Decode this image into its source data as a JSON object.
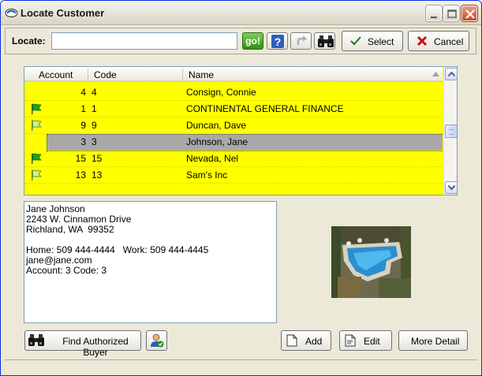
{
  "window": {
    "title": "Locate Customer"
  },
  "toolbar": {
    "locate_label": "Locate:",
    "locate_value": "",
    "go_label": "go!",
    "select_label": "Select",
    "cancel_label": "Cancel"
  },
  "grid": {
    "columns": [
      "Account",
      "Code",
      "Name"
    ],
    "rows": [
      {
        "account": "4",
        "code": "4",
        "name": "Consign, Connie",
        "flag": "none",
        "selected": false
      },
      {
        "account": "1",
        "code": "1",
        "name": "CONTINENTAL GENERAL FINANCE",
        "flag": "green",
        "selected": false
      },
      {
        "account": "9",
        "code": "9",
        "name": "Duncan, Dave",
        "flag": "outline",
        "selected": false
      },
      {
        "account": "3",
        "code": "3",
        "name": "Johnson, Jane",
        "flag": "none",
        "selected": true
      },
      {
        "account": "15",
        "code": "15",
        "name": "Nevada, Nel",
        "flag": "green",
        "selected": false
      },
      {
        "account": "13",
        "code": "13",
        "name": "Sam's Inc",
        "flag": "outline",
        "selected": false
      }
    ]
  },
  "detail": {
    "line1": "Jane Johnson",
    "line2": "2243 W. Cinnamon Drive",
    "line3": "Richland, WA  99352",
    "line4": "",
    "line5": "Home: 509 444-4444   Work: 509 444-4445",
    "line6": "jane@jane.com",
    "line7": "Account: 3 Code: 3"
  },
  "buttons": {
    "find_buyer": "Find Authorized Buyer",
    "add": "Add",
    "edit": "Edit",
    "more_detail": "More Detail"
  },
  "colors": {
    "grid_background": "#ffff00",
    "selected_row": "#a9a9a9",
    "go_button": "#3a9a1c",
    "window_face": "#ece9d8"
  },
  "icons": [
    "window-icon",
    "minimize-icon",
    "maximize-icon",
    "close-icon",
    "help-icon",
    "redo-icon",
    "binoculars-icon",
    "checkmark-icon",
    "x-icon",
    "flag-icon",
    "sort-arrow-icon",
    "scroll-up-icon",
    "scroll-down-icon",
    "buyer-icon",
    "document-icon",
    "edit-document-icon",
    "pool-photo"
  ]
}
